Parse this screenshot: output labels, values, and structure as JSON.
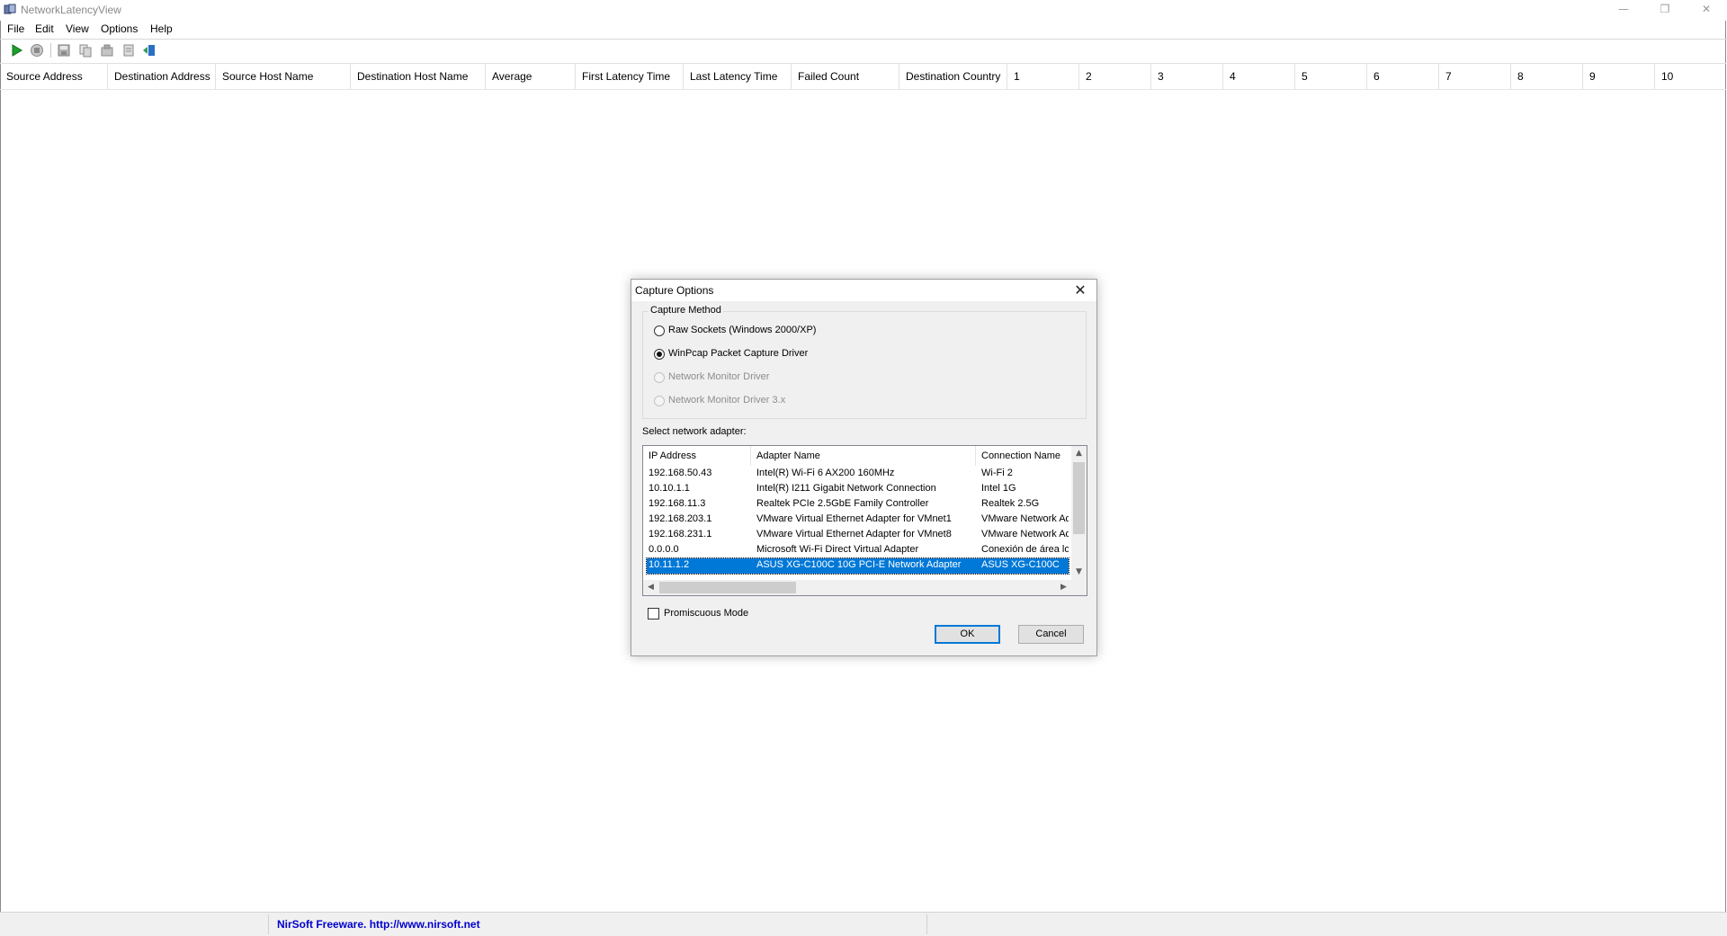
{
  "window": {
    "title": "NetworkLatencyView",
    "controls": [
      "minimize-icon",
      "restore-icon",
      "close-icon"
    ]
  },
  "menu": [
    "File",
    "Edit",
    "View",
    "Options",
    "Help"
  ],
  "toolbar": {
    "buttons": [
      "start-capture-icon",
      "stop-capture-icon",
      "save-icon",
      "copy-icon",
      "properties-icon",
      "html-report-icon",
      "exit-icon"
    ]
  },
  "list": {
    "columns": [
      "Source Address",
      "Destination Address",
      "Source Host Name",
      "Destination Host Name",
      "Average",
      "First Latency Time",
      "Last Latency Time",
      "Failed Count",
      "Destination Country",
      "1",
      "2",
      "3",
      "4",
      "5",
      "6",
      "7",
      "8",
      "9",
      "10"
    ]
  },
  "status": {
    "text": "NirSoft Freeware.  http://www.nirsoft.net"
  },
  "dialog": {
    "title": "Capture Options",
    "group_label": "Capture Method",
    "methods": [
      {
        "label": "Raw Sockets (Windows 2000/XP)",
        "checked": false,
        "enabled": true
      },
      {
        "label": "WinPcap Packet Capture Driver",
        "checked": true,
        "enabled": true
      },
      {
        "label": "Network Monitor Driver",
        "checked": false,
        "enabled": false
      },
      {
        "label": "Network Monitor Driver 3.x",
        "checked": false,
        "enabled": false
      }
    ],
    "adapter_label": "Select network adapter:",
    "adapter_columns": [
      "IP Address",
      "Adapter Name",
      "Connection Name"
    ],
    "adapters": [
      {
        "ip": "192.168.50.43",
        "name": "Intel(R) Wi-Fi 6 AX200 160MHz",
        "conn": "Wi-Fi 2"
      },
      {
        "ip": "10.10.1.1",
        "name": "Intel(R) I211 Gigabit Network Connection",
        "conn": "Intel 1G"
      },
      {
        "ip": "192.168.11.3",
        "name": "Realtek PCIe 2.5GbE Family Controller",
        "conn": "Realtek 2.5G"
      },
      {
        "ip": "192.168.203.1",
        "name": "VMware Virtual Ethernet Adapter for VMnet1",
        "conn": "VMware Network Ad"
      },
      {
        "ip": "192.168.231.1",
        "name": "VMware Virtual Ethernet Adapter for VMnet8",
        "conn": "VMware Network Ad"
      },
      {
        "ip": "0.0.0.0",
        "name": "Microsoft Wi-Fi Direct Virtual Adapter",
        "conn": "Conexión de área loc"
      },
      {
        "ip": "10.11.1.2",
        "name": "ASUS XG-C100C 10G PCI-E Network Adapter",
        "conn": "ASUS XG-C100C",
        "selected": true
      }
    ],
    "promiscuous_label": "Promiscuous Mode",
    "promiscuous_checked": false,
    "ok_label": "OK",
    "cancel_label": "Cancel"
  }
}
